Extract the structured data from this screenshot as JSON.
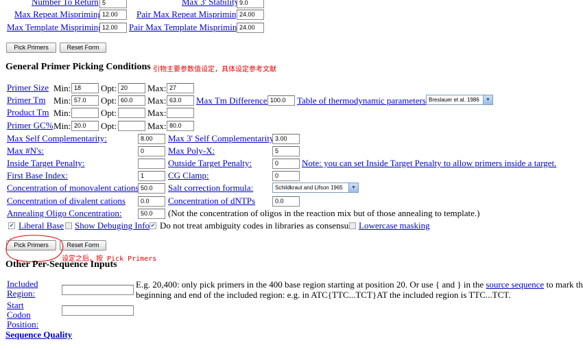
{
  "top_rows": {
    "number_to_return_label": "Number To Return",
    "number_to_return_value": "5",
    "max3_stability_label": "Max 3' Stability",
    "max3_stability_value": "9.0",
    "max_repeat_label": "Max Repeat Mispriming",
    "max_repeat_value": "12.00",
    "pair_max_repeat_label": "Pair Max Repeat Mispriming",
    "pair_max_repeat_value": "24.00",
    "max_template_label": "Max Template Mispriming",
    "max_template_value": "12.00",
    "pair_max_template_label": "Pair Max Template Mispriming",
    "pair_max_template_value": "24.00"
  },
  "buttons": {
    "pick_primers": "Pick Primers",
    "reset_form": "Reset Form"
  },
  "general_section": {
    "title": "General Primer Picking Conditions",
    "annotation": "引物主要参数值设定，具体设定参考文献"
  },
  "labels": {
    "min": "Min:",
    "opt": "Opt:",
    "max": "Max:"
  },
  "primer_size": {
    "label": "Primer Size",
    "min": "18",
    "opt": "20",
    "max": "27"
  },
  "primer_tm": {
    "label": "Primer Tm",
    "min": "57.0",
    "opt": "60.0",
    "max": "63.0"
  },
  "product_tm": {
    "label": "Product Tm",
    "min": "",
    "opt": "",
    "max": ""
  },
  "primer_gc": {
    "label": "Primer GC%",
    "min": "20.0",
    "opt": "",
    "max": "80.0"
  },
  "max_tm_diff": {
    "label": "Max Tm Difference:",
    "value": "100.0"
  },
  "thermo_table": {
    "label": "Table of thermodynamic parameters:",
    "selected": "Breslauer et al. 1986"
  },
  "params": {
    "max_self_comp": {
      "label": "Max Self Complementarity:",
      "value": "8.00"
    },
    "max3_self_comp": {
      "label": "Max 3' Self Complementarity:",
      "value": "3.00"
    },
    "max_ns": {
      "label": "Max #N's:",
      "value": "0"
    },
    "max_poly_x": {
      "label": "Max Poly-X:",
      "value": "5"
    },
    "inside_target": {
      "label": "Inside Target Penalty:",
      "value": ""
    },
    "outside_target": {
      "label": "Outside Target Penalty:",
      "value": "0"
    },
    "inside_note": "Note: you can set Inside Target Penalty to allow primers inside a target.",
    "first_base": {
      "label": "First Base Index:",
      "value": "1"
    },
    "cg_clamp": {
      "label": "CG Clamp:",
      "value": "0"
    },
    "monovalent": {
      "label": "Concentration of monovalent cations:",
      "value": "50.0"
    },
    "salt_formula": {
      "label": "Salt correction formula:",
      "selected": "Schildkraut and Lifson 1965"
    },
    "divalent": {
      "label": "Concentration of divalent cations",
      "value": "0.0"
    },
    "dntps": {
      "label": "Concentration of dNTPs",
      "value": "0.0"
    },
    "annealing": {
      "label": "Annealing Oligo Concentration:",
      "value": "50.0"
    },
    "annealing_note": "(Not the concentration of oligos in the reaction mix but of those annealing to template.)"
  },
  "checkboxes": {
    "liberal_base": {
      "label": "Liberal Base",
      "checked": true
    },
    "show_debug": {
      "label": "Show Debuging Info",
      "checked": false
    },
    "ambiguity": {
      "label": "Do not treat ambiguity codes in libraries as consensus",
      "checked": true
    },
    "lowercase": {
      "label": "Lowercase masking",
      "checked": false
    }
  },
  "pick_annotation": "设定之后，按 Pick Primers",
  "other_section": {
    "title": "Other Per-Sequence Inputs",
    "included_region_label": "Included Region:",
    "included_region_value": "",
    "included_text_1": "E.g. 20,400: only pick primers in the 400 base region starting at position 20. Or use { and } in the",
    "included_link": "source sequence",
    "included_text_2": "to mark the",
    "included_text_3": "beginning and end of the included region: e.g. in ATC{TTC...TCT}AT the included region is TTC...TCT.",
    "start_codon_label": "Start Codon Position:",
    "start_codon_value": ""
  },
  "sequence_quality": "Sequence Quality",
  "colors": {
    "link": "#0000cc",
    "annotation": "#e00000"
  }
}
